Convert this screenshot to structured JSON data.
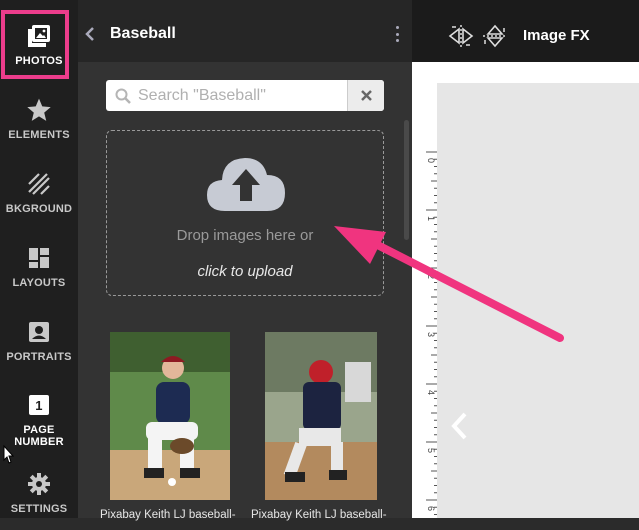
{
  "sidebar": {
    "items": [
      {
        "label": "PHOTOS",
        "icon": "photos-icon"
      },
      {
        "label": "ELEMENTS",
        "icon": "star-icon"
      },
      {
        "label": "BKGROUND",
        "icon": "background-icon"
      },
      {
        "label": "LAYOUTS",
        "icon": "layouts-icon"
      },
      {
        "label": "PORTRAITS",
        "icon": "portrait-icon"
      },
      {
        "label": "PAGE\nNUMBER",
        "icon": "page-number-icon",
        "badge": "1"
      },
      {
        "label": "SETTINGS",
        "icon": "gear-icon"
      }
    ],
    "active": "PHOTOS",
    "highlight_color": "#ec3d8c"
  },
  "panel": {
    "title": "Baseball",
    "search": {
      "placeholder": "Search \"Baseball\"",
      "value": ""
    },
    "dropzone": {
      "text": "Drop images here or",
      "link": "click to upload"
    },
    "photos": [
      {
        "caption": "Pixabay Keith LJ baseball-"
      },
      {
        "caption": "Pixabay Keith LJ baseball-"
      }
    ]
  },
  "topbar": {
    "title": "Image FX",
    "icons": [
      "flip-horizontal-icon",
      "flip-vertical-icon"
    ]
  },
  "ruler": {
    "ticks": [
      "0",
      "1",
      "2",
      "3",
      "4",
      "5",
      "6"
    ]
  },
  "annotation": {
    "color": "#f0347f"
  }
}
